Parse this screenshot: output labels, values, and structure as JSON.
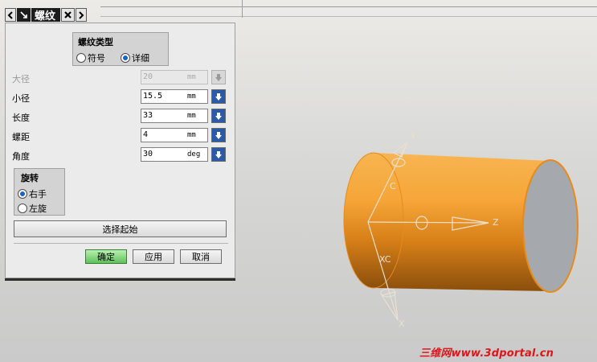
{
  "dialog": {
    "title": "螺纹",
    "thread_type": {
      "label": "螺纹类型",
      "options": [
        "符号",
        "详细"
      ],
      "selected": "详细"
    },
    "fields": [
      {
        "label": "大径",
        "value": "20",
        "unit": "mm",
        "enabled": false
      },
      {
        "label": "小径",
        "value": "15.5",
        "unit": "mm",
        "enabled": true
      },
      {
        "label": "长度",
        "value": "33",
        "unit": "mm",
        "enabled": true
      },
      {
        "label": "螺距",
        "value": "4",
        "unit": "mm",
        "enabled": true
      },
      {
        "label": "角度",
        "value": "30",
        "unit": "deg",
        "enabled": true
      }
    ],
    "rotation": {
      "label": "旋转",
      "options": [
        "右手",
        "左旋"
      ],
      "selected": "右手"
    },
    "select_start_label": "选择起始",
    "ok_label": "确定",
    "apply_label": "应用",
    "cancel_label": "取消"
  },
  "viewport": {
    "axes": {
      "y": "Y",
      "z": "Z",
      "xc": "XC",
      "x": "X",
      "c": "C"
    },
    "cylinder_color": "#f5a83a"
  },
  "watermark": "三维网www.3dportal.cn"
}
